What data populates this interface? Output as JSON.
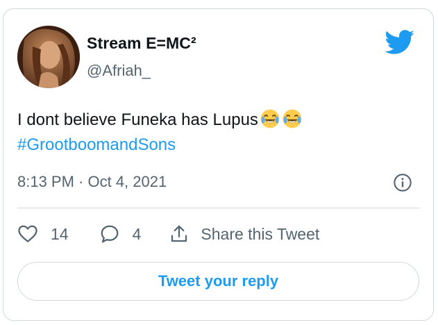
{
  "author": {
    "display_name": "Stream E=MC²",
    "handle": "@Afriah_",
    "avatar_icon": "profile-photo"
  },
  "tweet": {
    "text": "I dont believe Funeka has Lupus",
    "emojis": [
      "face-with-tears-of-joy",
      "face-with-tears-of-joy"
    ],
    "hashtag": "#GrootboomandSons",
    "timestamp": "8:13 PM · Oct 4, 2021"
  },
  "actions": {
    "like_count": "14",
    "reply_count": "4",
    "share_label": "Share this Tweet"
  },
  "reply_button_label": "Tweet your reply",
  "colors": {
    "brand_blue": "#1d9bf0",
    "text": "#0f1419",
    "secondary": "#536471",
    "border": "#cfd9de"
  }
}
